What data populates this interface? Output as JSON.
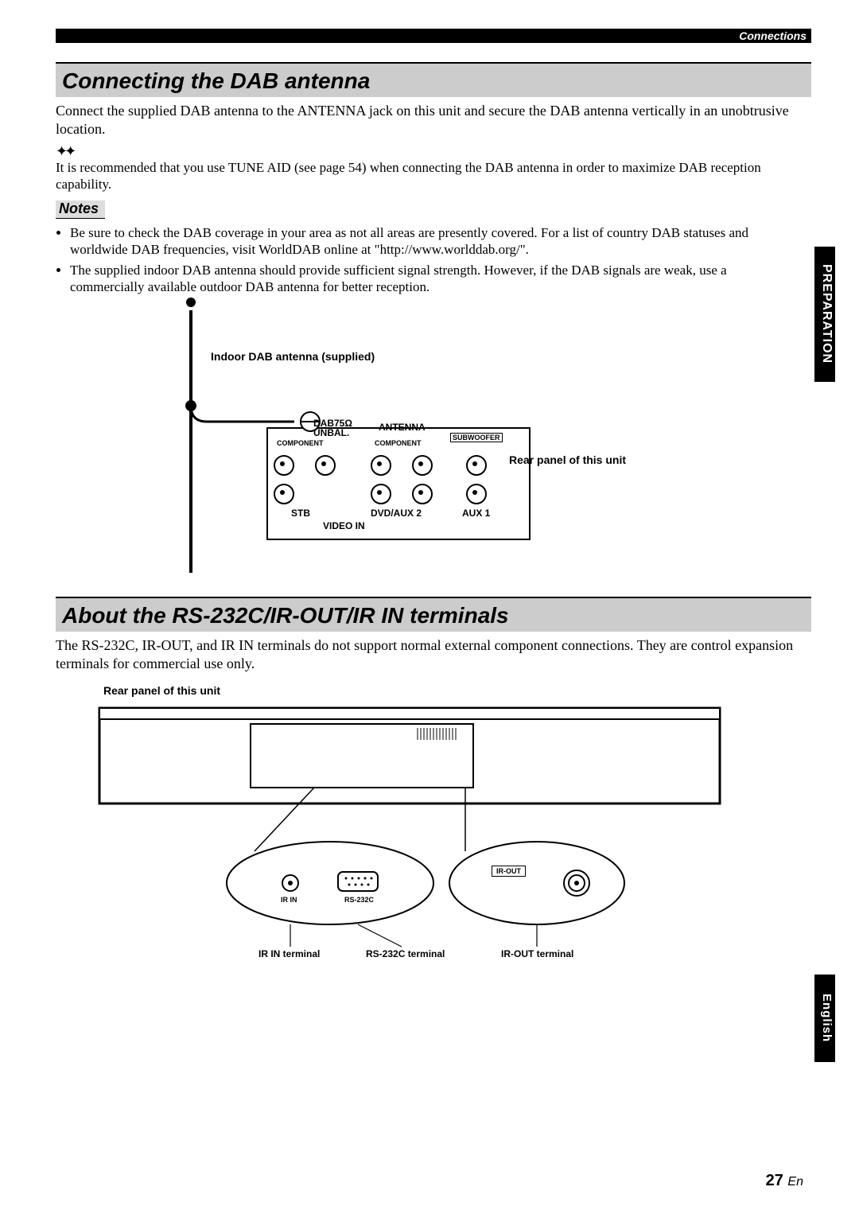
{
  "header": {
    "category": "Connections"
  },
  "side_tabs": {
    "preparation": "PREPARATION",
    "english": "English"
  },
  "section1": {
    "title": "Connecting the DAB antenna",
    "intro": "Connect the supplied DAB antenna to the ANTENNA jack on this unit and secure the DAB antenna vertically in an unobtrusive location.",
    "tip": "It is recommended that you use TUNE AID (see page 54) when connecting the DAB antenna in order to maximize DAB reception capability.",
    "notes_label": "Notes",
    "notes": [
      "Be sure to check the DAB coverage in your area as not all areas are presently covered. For a list of country DAB statuses and worldwide DAB frequencies, visit WorldDAB online at \"http://www.worlddab.org/\".",
      "The supplied indoor DAB antenna should provide sufficient signal strength. However, if the DAB signals are weak, use a commercially available outdoor DAB antenna for better reception."
    ]
  },
  "diagram1": {
    "antenna_label": "Indoor DAB antenna (supplied)",
    "rear_panel_label": "Rear panel of this unit",
    "panel": {
      "dab": "DAB75Ω UNBAL.",
      "antenna": "ANTENNA",
      "component1": "COMPONENT",
      "component2": "COMPONENT",
      "subwoofer": "SUBWOOFER",
      "stb": "STB",
      "dvd": "DVD/AUX 2",
      "aux1": "AUX 1",
      "video_in": "VIDEO IN"
    }
  },
  "section2": {
    "title": "About the RS-232C/IR-OUT/IR IN terminals",
    "body": "The RS-232C, IR-OUT, and IR IN terminals do not support normal external component connections. They are control expansion terminals for commercial use only."
  },
  "diagram2": {
    "rear_panel_label": "Rear panel of this unit",
    "ir_in_small": "IR IN",
    "rs232_small": "RS-232C",
    "ir_out_small": "IR-OUT",
    "ir_in_label": "IR IN terminal",
    "rs232_label": "RS-232C terminal",
    "ir_out_label": "IR-OUT terminal"
  },
  "footer": {
    "page": "27",
    "suffix": "En"
  }
}
